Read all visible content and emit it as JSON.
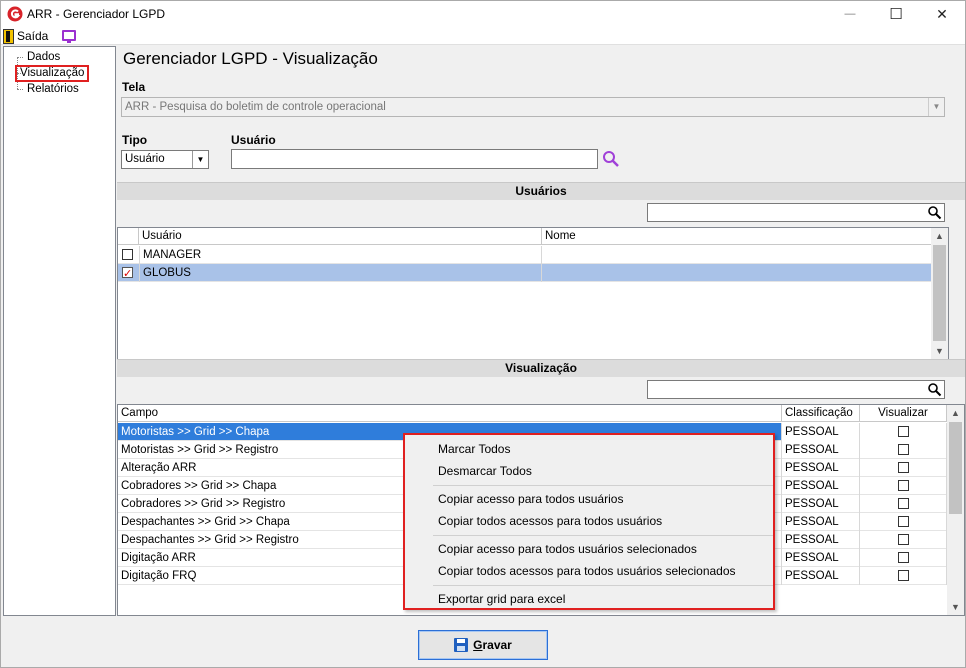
{
  "window": {
    "title": "ARR - Gerenciador LGPD",
    "minimize": "—",
    "maximize": "☐",
    "close": "✕"
  },
  "menu": {
    "exit_label": "Saída"
  },
  "tree": {
    "items": [
      {
        "label": "Dados"
      },
      {
        "label": "Visualização"
      },
      {
        "label": "Relatórios"
      }
    ]
  },
  "page": {
    "title": "Gerenciador LGPD - Visualização"
  },
  "tela": {
    "label": "Tela",
    "value": "ARR - Pesquisa do boletim de controle operacional"
  },
  "tipo": {
    "label": "Tipo",
    "value": "Usuário"
  },
  "usuario": {
    "label": "Usuário",
    "value": ""
  },
  "usuarios_section": {
    "header": "Usuários",
    "columns": [
      "Usuário",
      "Nome"
    ],
    "rows": [
      {
        "usuario": "MANAGER",
        "nome": "",
        "checked": false
      },
      {
        "usuario": "GLOBUS",
        "nome": "",
        "checked": true
      }
    ]
  },
  "visualizacao_section": {
    "header": "Visualização",
    "columns": [
      "Campo",
      "Classificação",
      "Visualizar"
    ],
    "rows": [
      {
        "campo": "Motoristas >> Grid >> Chapa",
        "classificacao": "PESSOAL",
        "visualizar": false
      },
      {
        "campo": "Motoristas >> Grid >> Registro",
        "classificacao": "PESSOAL",
        "visualizar": false
      },
      {
        "campo": "Alteração ARR",
        "classificacao": "PESSOAL",
        "visualizar": false
      },
      {
        "campo": "Cobradores >> Grid >> Chapa",
        "classificacao": "PESSOAL",
        "visualizar": false
      },
      {
        "campo": "Cobradores >> Grid >> Registro",
        "classificacao": "PESSOAL",
        "visualizar": false
      },
      {
        "campo": "Despachantes >> Grid >> Chapa",
        "classificacao": "PESSOAL",
        "visualizar": false
      },
      {
        "campo": "Despachantes >> Grid >> Registro",
        "classificacao": "PESSOAL",
        "visualizar": false
      },
      {
        "campo": "Digitação ARR",
        "classificacao": "PESSOAL",
        "visualizar": false
      },
      {
        "campo": "Digitação FRQ",
        "classificacao": "PESSOAL",
        "visualizar": false
      }
    ]
  },
  "context_menu": {
    "items": [
      "Marcar Todos",
      "Desmarcar Todos",
      "Copiar acesso para todos usuários",
      "Copiar todos acessos para todos usuários",
      "Copiar acesso para todos usuários selecionados",
      "Copiar todos acessos para todos usuários selecionados",
      "Exportar grid para excel"
    ]
  },
  "save_button": {
    "label_accel": "G",
    "label_rest": "ravar"
  },
  "colors": {
    "selected_row_user": "#a9c2e8",
    "selected_row_field": "#2f7ddb",
    "highlight_border": "#e02020",
    "accent_purple": "#9b30d0"
  }
}
